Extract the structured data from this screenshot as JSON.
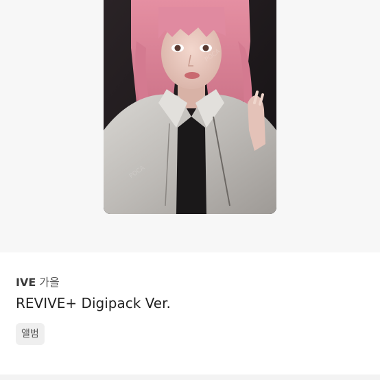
{
  "product": {
    "artist": "IVE",
    "member": "가을",
    "album": "REVIVE+ Digipack Ver.",
    "category_tag": "앨범"
  },
  "colors": {
    "image_background": "#f7f7f7",
    "tag_background": "#efefef",
    "title_text": "#222222"
  },
  "image": {
    "subject": "photocard-photo",
    "icon_name": "photocard-image"
  }
}
